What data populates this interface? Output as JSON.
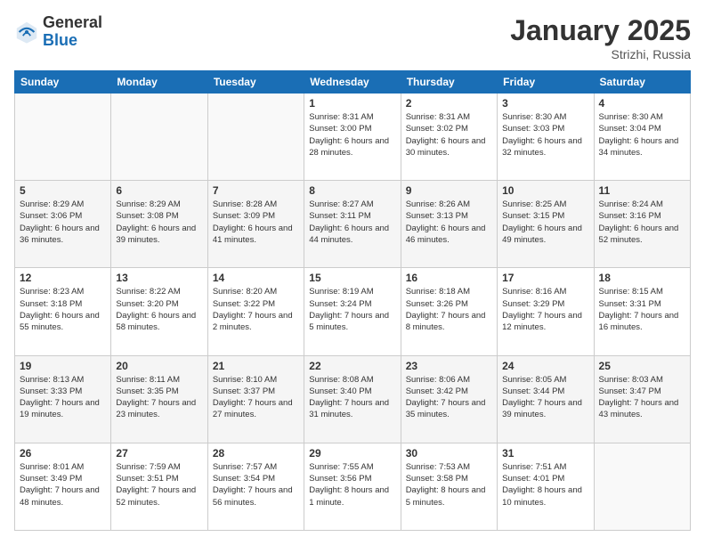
{
  "logo": {
    "general": "General",
    "blue": "Blue"
  },
  "title": "January 2025",
  "location": "Strizhi, Russia",
  "days_of_week": [
    "Sunday",
    "Monday",
    "Tuesday",
    "Wednesday",
    "Thursday",
    "Friday",
    "Saturday"
  ],
  "weeks": [
    [
      {
        "day": "",
        "sunrise": "",
        "sunset": "",
        "daylight": ""
      },
      {
        "day": "",
        "sunrise": "",
        "sunset": "",
        "daylight": ""
      },
      {
        "day": "",
        "sunrise": "",
        "sunset": "",
        "daylight": ""
      },
      {
        "day": "1",
        "sunrise": "Sunrise: 8:31 AM",
        "sunset": "Sunset: 3:00 PM",
        "daylight": "Daylight: 6 hours and 28 minutes."
      },
      {
        "day": "2",
        "sunrise": "Sunrise: 8:31 AM",
        "sunset": "Sunset: 3:02 PM",
        "daylight": "Daylight: 6 hours and 30 minutes."
      },
      {
        "day": "3",
        "sunrise": "Sunrise: 8:30 AM",
        "sunset": "Sunset: 3:03 PM",
        "daylight": "Daylight: 6 hours and 32 minutes."
      },
      {
        "day": "4",
        "sunrise": "Sunrise: 8:30 AM",
        "sunset": "Sunset: 3:04 PM",
        "daylight": "Daylight: 6 hours and 34 minutes."
      }
    ],
    [
      {
        "day": "5",
        "sunrise": "Sunrise: 8:29 AM",
        "sunset": "Sunset: 3:06 PM",
        "daylight": "Daylight: 6 hours and 36 minutes."
      },
      {
        "day": "6",
        "sunrise": "Sunrise: 8:29 AM",
        "sunset": "Sunset: 3:08 PM",
        "daylight": "Daylight: 6 hours and 39 minutes."
      },
      {
        "day": "7",
        "sunrise": "Sunrise: 8:28 AM",
        "sunset": "Sunset: 3:09 PM",
        "daylight": "Daylight: 6 hours and 41 minutes."
      },
      {
        "day": "8",
        "sunrise": "Sunrise: 8:27 AM",
        "sunset": "Sunset: 3:11 PM",
        "daylight": "Daylight: 6 hours and 44 minutes."
      },
      {
        "day": "9",
        "sunrise": "Sunrise: 8:26 AM",
        "sunset": "Sunset: 3:13 PM",
        "daylight": "Daylight: 6 hours and 46 minutes."
      },
      {
        "day": "10",
        "sunrise": "Sunrise: 8:25 AM",
        "sunset": "Sunset: 3:15 PM",
        "daylight": "Daylight: 6 hours and 49 minutes."
      },
      {
        "day": "11",
        "sunrise": "Sunrise: 8:24 AM",
        "sunset": "Sunset: 3:16 PM",
        "daylight": "Daylight: 6 hours and 52 minutes."
      }
    ],
    [
      {
        "day": "12",
        "sunrise": "Sunrise: 8:23 AM",
        "sunset": "Sunset: 3:18 PM",
        "daylight": "Daylight: 6 hours and 55 minutes."
      },
      {
        "day": "13",
        "sunrise": "Sunrise: 8:22 AM",
        "sunset": "Sunset: 3:20 PM",
        "daylight": "Daylight: 6 hours and 58 minutes."
      },
      {
        "day": "14",
        "sunrise": "Sunrise: 8:20 AM",
        "sunset": "Sunset: 3:22 PM",
        "daylight": "Daylight: 7 hours and 2 minutes."
      },
      {
        "day": "15",
        "sunrise": "Sunrise: 8:19 AM",
        "sunset": "Sunset: 3:24 PM",
        "daylight": "Daylight: 7 hours and 5 minutes."
      },
      {
        "day": "16",
        "sunrise": "Sunrise: 8:18 AM",
        "sunset": "Sunset: 3:26 PM",
        "daylight": "Daylight: 7 hours and 8 minutes."
      },
      {
        "day": "17",
        "sunrise": "Sunrise: 8:16 AM",
        "sunset": "Sunset: 3:29 PM",
        "daylight": "Daylight: 7 hours and 12 minutes."
      },
      {
        "day": "18",
        "sunrise": "Sunrise: 8:15 AM",
        "sunset": "Sunset: 3:31 PM",
        "daylight": "Daylight: 7 hours and 16 minutes."
      }
    ],
    [
      {
        "day": "19",
        "sunrise": "Sunrise: 8:13 AM",
        "sunset": "Sunset: 3:33 PM",
        "daylight": "Daylight: 7 hours and 19 minutes."
      },
      {
        "day": "20",
        "sunrise": "Sunrise: 8:11 AM",
        "sunset": "Sunset: 3:35 PM",
        "daylight": "Daylight: 7 hours and 23 minutes."
      },
      {
        "day": "21",
        "sunrise": "Sunrise: 8:10 AM",
        "sunset": "Sunset: 3:37 PM",
        "daylight": "Daylight: 7 hours and 27 minutes."
      },
      {
        "day": "22",
        "sunrise": "Sunrise: 8:08 AM",
        "sunset": "Sunset: 3:40 PM",
        "daylight": "Daylight: 7 hours and 31 minutes."
      },
      {
        "day": "23",
        "sunrise": "Sunrise: 8:06 AM",
        "sunset": "Sunset: 3:42 PM",
        "daylight": "Daylight: 7 hours and 35 minutes."
      },
      {
        "day": "24",
        "sunrise": "Sunrise: 8:05 AM",
        "sunset": "Sunset: 3:44 PM",
        "daylight": "Daylight: 7 hours and 39 minutes."
      },
      {
        "day": "25",
        "sunrise": "Sunrise: 8:03 AM",
        "sunset": "Sunset: 3:47 PM",
        "daylight": "Daylight: 7 hours and 43 minutes."
      }
    ],
    [
      {
        "day": "26",
        "sunrise": "Sunrise: 8:01 AM",
        "sunset": "Sunset: 3:49 PM",
        "daylight": "Daylight: 7 hours and 48 minutes."
      },
      {
        "day": "27",
        "sunrise": "Sunrise: 7:59 AM",
        "sunset": "Sunset: 3:51 PM",
        "daylight": "Daylight: 7 hours and 52 minutes."
      },
      {
        "day": "28",
        "sunrise": "Sunrise: 7:57 AM",
        "sunset": "Sunset: 3:54 PM",
        "daylight": "Daylight: 7 hours and 56 minutes."
      },
      {
        "day": "29",
        "sunrise": "Sunrise: 7:55 AM",
        "sunset": "Sunset: 3:56 PM",
        "daylight": "Daylight: 8 hours and 1 minute."
      },
      {
        "day": "30",
        "sunrise": "Sunrise: 7:53 AM",
        "sunset": "Sunset: 3:58 PM",
        "daylight": "Daylight: 8 hours and 5 minutes."
      },
      {
        "day": "31",
        "sunrise": "Sunrise: 7:51 AM",
        "sunset": "Sunset: 4:01 PM",
        "daylight": "Daylight: 8 hours and 10 minutes."
      },
      {
        "day": "",
        "sunrise": "",
        "sunset": "",
        "daylight": ""
      }
    ]
  ]
}
